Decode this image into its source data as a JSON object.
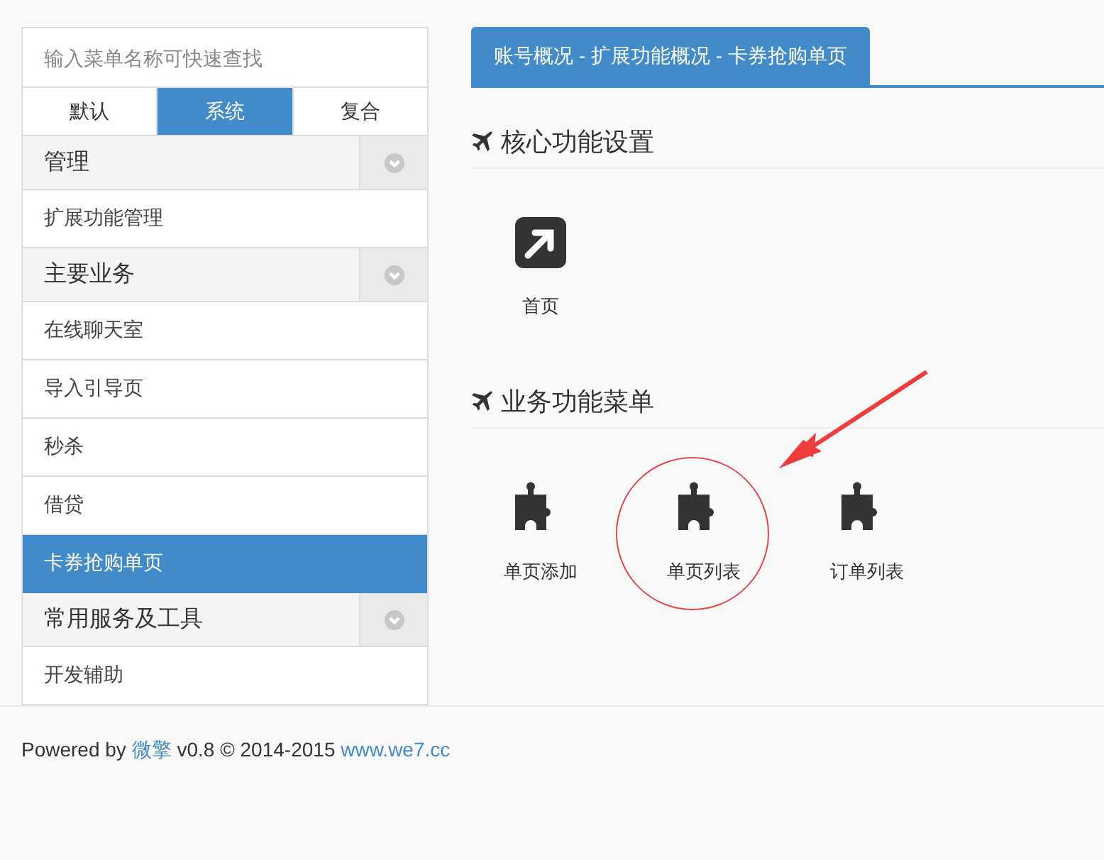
{
  "sidebar": {
    "search": {
      "placeholder": "输入菜单名称可快速查找"
    },
    "tabs": [
      {
        "label": "默认",
        "selected": false
      },
      {
        "label": "系统",
        "selected": true
      },
      {
        "label": "复合",
        "selected": false
      }
    ],
    "groups": [
      {
        "title": "管理",
        "expanded": true,
        "items": [
          {
            "label": "扩展功能管理",
            "selected": false
          }
        ]
      },
      {
        "title": "主要业务",
        "expanded": true,
        "items": [
          {
            "label": "在线聊天室",
            "selected": false
          },
          {
            "label": "导入引导页",
            "selected": false
          },
          {
            "label": "秒杀",
            "selected": false
          },
          {
            "label": "借贷",
            "selected": false
          },
          {
            "label": "卡券抢购单页",
            "selected": true
          }
        ]
      },
      {
        "title": "常用服务及工具",
        "expanded": true,
        "items": [
          {
            "label": "开发辅助",
            "selected": false
          }
        ]
      }
    ]
  },
  "main": {
    "breadcrumb_tab": "账号概况 - 扩展功能概况 - 卡券抢购单页",
    "sections": [
      {
        "title": "核心功能设置",
        "tiles": [
          {
            "label": "首页",
            "kind": "link",
            "annotated": false
          }
        ]
      },
      {
        "title": "业务功能菜单",
        "tiles": [
          {
            "label": "单页添加",
            "kind": "module",
            "annotated": false
          },
          {
            "label": "单页列表",
            "kind": "module",
            "annotated": true
          },
          {
            "label": "订单列表",
            "kind": "module",
            "annotated": false
          }
        ]
      }
    ]
  },
  "footer": [
    {
      "kind": "text",
      "text": "Powered by "
    },
    {
      "kind": "link",
      "text": "微擎"
    },
    {
      "kind": "text",
      "text": " v0.8 © 2014-2015 "
    },
    {
      "kind": "link",
      "text": "www.we7.cc"
    }
  ]
}
